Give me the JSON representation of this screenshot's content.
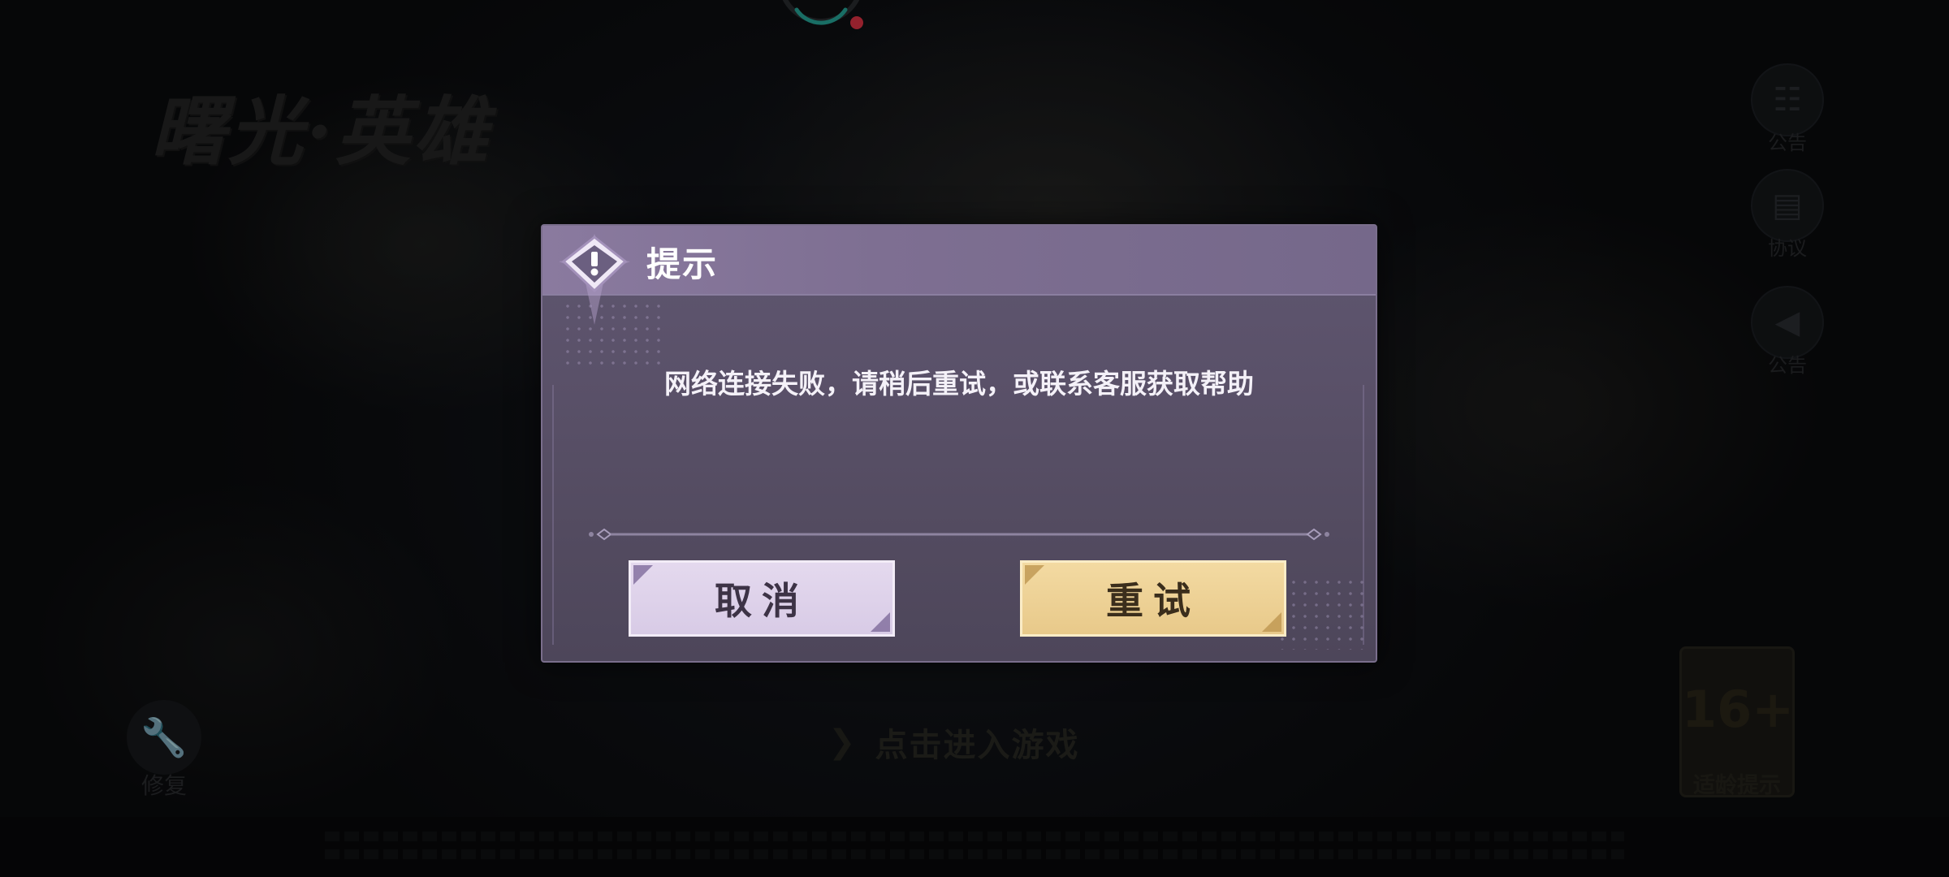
{
  "background": {
    "game_logo_text": "曙光·英雄",
    "side_menu": [
      {
        "label": "公告",
        "icon": "announcement-icon"
      },
      {
        "label": "协议",
        "icon": "document-icon"
      },
      {
        "label": "公告",
        "icon": "megaphone-icon"
      }
    ],
    "repair_label": "修复",
    "enter_game_label": "点击进入游戏",
    "age_rating": {
      "number": "16+",
      "label": "适龄提示"
    }
  },
  "dialog": {
    "title": "提示",
    "message": "网络连接失败，请稍后重试，或联系客服获取帮助",
    "cancel_label": "取消",
    "retry_label": "重试",
    "colors": {
      "header": "#7e6f92",
      "body": "#5a5169",
      "cancel_button": "#dcd0e9",
      "retry_button": "#eccf90"
    }
  },
  "loader": {
    "accent": "#2ec4b6",
    "badge": "#ff3b4a"
  }
}
